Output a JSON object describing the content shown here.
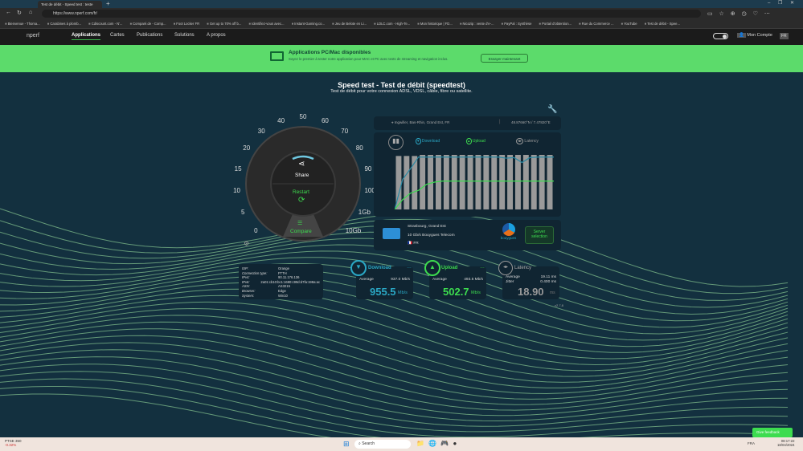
{
  "browser": {
    "tab_title": "Test de débit - Speed test : teste",
    "url": "https://www.nperf.com/fr/",
    "bookmarks": [
      "Bienvenue - Thoma...",
      "Carabines à plomb...",
      "Cdiscount.com - N'...",
      "Comparé.de - Comp...",
      "Foot Locker FR",
      "Get up to 70% off b...",
      "Identifiez-vous avec...",
      "Instant-Gaming.co...",
      "Jeu de Belote en Li...",
      "LDLC.com - High-Te...",
      "Mon historique | FD...",
      "Nicozip : vente d'e-...",
      "PayPal : Synthèse",
      "Portail d'obtention...",
      "Rue du Commerce ...",
      "YouTube",
      "Test de débit - Spee..."
    ]
  },
  "site": {
    "logo": "nperf",
    "nav": [
      "Applications",
      "Cartes",
      "Publications",
      "Solutions",
      "A propos"
    ],
    "account": "Mon Compte",
    "lang": "FR"
  },
  "banner": {
    "title": "Applications PC/Mac disponibles",
    "text": "Soyez le premier à tester notre application pour MAC et PC avec tests de streaming et navigation inclus.",
    "button": "Essayer maintenant"
  },
  "page": {
    "title": "Speed test - Test de débit (speedtest)",
    "subtitle": "Test de débit pour votre connexion ADSL, VDSL, câble, fibre ou satellite."
  },
  "gauge": {
    "ticks": [
      "0",
      "5",
      "10",
      "15",
      "20",
      "30",
      "40",
      "50",
      "60",
      "70",
      "80",
      "90",
      "100",
      "1Gb",
      "10Gb"
    ],
    "share": "Share",
    "restart": "Restart",
    "compare": "Compare"
  },
  "location": {
    "place": "Ingwiller, Bas-Rhin, Grand Est, FR",
    "coords": "48.87660°N / 7.47820°E"
  },
  "legend": {
    "download": "Download",
    "upload": "Upload",
    "latency": "Latency"
  },
  "chart": {
    "bars": [
      0.98,
      0.98,
      0.98,
      1,
      1,
      1,
      1,
      1,
      1,
      1,
      1,
      1,
      1,
      1,
      1,
      1,
      1,
      1,
      1,
      1
    ],
    "download": [
      0,
      0.55,
      0.75,
      0.96,
      0.96,
      0.96,
      0.96,
      0.96,
      0.96,
      0.96,
      0.96,
      0.96,
      0.96,
      0.96,
      0.94,
      0.95,
      0.86,
      0.95,
      0.96,
      0.96,
      0.96
    ],
    "upload": [
      0,
      0.18,
      0.3,
      0.35,
      0.46,
      0.5,
      0.52,
      0.52,
      0.52,
      0.52,
      0.52,
      0.52,
      0.52,
      0.52,
      0.52,
      0.52,
      0.52,
      0.52,
      0.52,
      0.52,
      0.52
    ]
  },
  "server": {
    "city": "Strasbourg, Grand Est",
    "provider": "10 Gb/s Bouygues Telecom",
    "country": "FR",
    "brand": "bouygues",
    "button": "Server selection"
  },
  "info": [
    [
      "ISP:",
      "Orange"
    ],
    [
      "Connection type:",
      "FTTH"
    ],
    [
      "IPv4:",
      "90.11.176.136"
    ],
    [
      "IPv6:",
      "2a01:cb10:bc1:1680:c99d:d7fa:198a:ac"
    ],
    [
      "ASN:",
      "AS3215"
    ],
    [
      "Browser:",
      "Edge"
    ],
    [
      "System:",
      "Win10"
    ]
  ],
  "results": {
    "download": {
      "label": "Download",
      "avg_label": "Average",
      "avg": "937.0 Mb/s",
      "value": "955.5",
      "unit": "Mb/s"
    },
    "upload": {
      "label": "Upload",
      "avg_label": "Average",
      "avg": "493.5 Mb/s",
      "value": "502.7",
      "unit": "Mb/s"
    },
    "latency": {
      "label": "Latency",
      "avg_label": "Average",
      "avg": "19.11 ms",
      "jitter_label": "Jitter",
      "jitter": "0.400 ms",
      "value": "18.90",
      "unit": "ms"
    }
  },
  "version": "v2.7.8",
  "feedback": "Give feedback",
  "taskbar": {
    "stock": "PTSE 350",
    "stock_change": "-0.32%",
    "search": "Search",
    "lang": "FRA",
    "time": "08:17:22",
    "date": "18/04/2024"
  },
  "colors": {
    "green": "#3ddc4f",
    "teal": "#2aa7c4",
    "banner": "#5cdb6b"
  }
}
